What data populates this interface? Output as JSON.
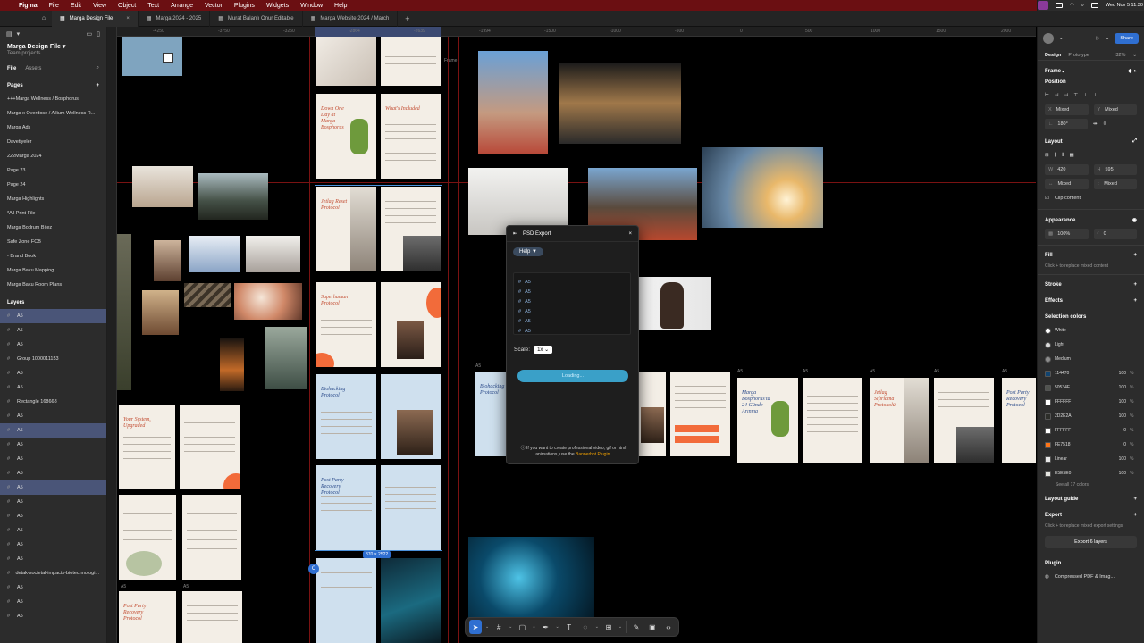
{
  "menubar": {
    "app": "Figma",
    "menus": [
      "File",
      "Edit",
      "View",
      "Object",
      "Text",
      "Arrange",
      "Vector",
      "Plugins",
      "Widgets",
      "Window",
      "Help"
    ],
    "clock": "Wed Nov 5  11:30"
  },
  "tabs": [
    {
      "label": "Marga Design File",
      "active": true
    },
    {
      "label": "Marga 2024 - 2025",
      "active": false
    },
    {
      "label": "Murat Balanlı Onur Editable",
      "active": false
    },
    {
      "label": "Marga Website 2024 / March",
      "active": false
    }
  ],
  "left": {
    "file_name": "Marga Design File",
    "team": "Team projects",
    "file_tab": "File",
    "assets_tab": "Assets",
    "pages_label": "Pages",
    "pages": [
      "+++Marga Wellness / Bosphorus",
      "Marga x Overdose / Allium Wellness R...",
      "Marga Ads",
      "Davetiyeler",
      "222Marga 2024",
      "Page 23",
      "Page 24",
      "Marga Highlights",
      "*All Print File",
      "Marga Bodrum Bitez",
      "Safe Zone FCB",
      "- Brand Book",
      "Marga Baku Mapping",
      "Marga Baku Room Plans"
    ],
    "layers_label": "Layers",
    "layers": [
      {
        "label": "A5",
        "selected": true
      },
      {
        "label": "A5",
        "selected": false
      },
      {
        "label": "A5",
        "selected": false
      },
      {
        "label": "Group 1000011153",
        "selected": false
      },
      {
        "label": "A5",
        "selected": false
      },
      {
        "label": "A5",
        "selected": false
      },
      {
        "label": "Rectangle 168668",
        "selected": false
      },
      {
        "label": "A5",
        "selected": false
      },
      {
        "label": "A5",
        "selected": true
      },
      {
        "label": "A5",
        "selected": false
      },
      {
        "label": "A5",
        "selected": false
      },
      {
        "label": "A5",
        "selected": false
      },
      {
        "label": "A5",
        "selected": true
      },
      {
        "label": "A5",
        "selected": false
      },
      {
        "label": "A5",
        "selected": false
      },
      {
        "label": "A5",
        "selected": false
      },
      {
        "label": "A5",
        "selected": false
      },
      {
        "label": "A5",
        "selected": false
      },
      {
        "label": "detak-societal-impacts-biotechnologi...",
        "selected": false
      },
      {
        "label": "A5",
        "selected": false
      },
      {
        "label": "A5",
        "selected": false
      },
      {
        "label": "A5",
        "selected": false
      }
    ]
  },
  "ruler": {
    "ticks": [
      "-4250",
      "-3750",
      "-3250",
      "-2864",
      "-2639",
      "-1994",
      "-1500",
      "-1000",
      "-500",
      "0",
      "500",
      "1000",
      "1500",
      "2000"
    ]
  },
  "canvas": {
    "frame_label": "Frame",
    "a5_label": "A5",
    "selection_size": "870 × 2522",
    "docs": [
      {
        "title": "Down One Day at Marga Bosphorus",
        "color": "red"
      },
      {
        "title": "What's Included",
        "color": "red"
      },
      {
        "title": "Jetlag Reset Protocol",
        "color": "red"
      },
      {
        "title": "Superhuman Protocol",
        "color": "red"
      },
      {
        "title": "Biohacking Protocol",
        "color": "blue"
      },
      {
        "title": "Post Party Recovery Protocol",
        "color": "blue"
      },
      {
        "title": "Your System, Upgraded",
        "color": "red"
      },
      {
        "title": "Post Party Recovery Protocol",
        "color": "red"
      },
      {
        "title": "Marga Bosphorus'ta 24 Günde Arınma",
        "color": "blue"
      },
      {
        "title": "Jetlag Sıfırlama Protokolü",
        "color": "red"
      }
    ]
  },
  "psd_export": {
    "title": "PSD Export",
    "help": "Help ▼",
    "items": [
      "A5",
      "A5",
      "A5",
      "A5",
      "A5",
      "A5"
    ],
    "scale_label": "Scale:",
    "scale_value": "1x",
    "loading": "Loading...",
    "note_prefix": "If you want to create professional video, gif or html animations, use the",
    "note_link": "Bannerbot Plugin."
  },
  "right": {
    "share": "Share",
    "zoom": "32%",
    "design_tab": "Design",
    "prototype_tab": "Prototype",
    "frame_label": "Frame",
    "position_label": "Position",
    "x_label": "X",
    "x_value": "Mixed",
    "y_label": "Y",
    "y_value": "Mixed",
    "rotation": "180°",
    "layout_label": "Layout",
    "w_label": "W",
    "w_value": "420",
    "h_label": "H",
    "h_value": "595",
    "w_mixed": "Mixed",
    "h_mixed": "Mixed",
    "clip_content": "Clip content",
    "appearance_label": "Appearance",
    "opacity": "100%",
    "radius": "0",
    "fill_label": "Fill",
    "fill_hint": "Click + to replace mixed content",
    "stroke_label": "Stroke",
    "effects_label": "Effects",
    "selection_colors_label": "Selection colors",
    "colors": [
      {
        "name": "White",
        "hex": "#ffffff",
        "style": true
      },
      {
        "name": "Light",
        "hex": "#d9d9d9",
        "style": true
      },
      {
        "name": "Medium",
        "hex": "#8c8c8c",
        "style": true
      },
      {
        "name": "114470",
        "hex": "#114470",
        "pct": "100"
      },
      {
        "name": "50534F",
        "hex": "#50534f",
        "pct": "100"
      },
      {
        "name": "FFFFFF",
        "hex": "#ffffff",
        "pct": "100"
      },
      {
        "name": "2D2E2A",
        "hex": "#2d2e2a",
        "pct": "100"
      },
      {
        "name": "FFFFFF",
        "hex": "#ffffff",
        "pct": "0"
      },
      {
        "name": "FE7518",
        "hex": "#fe7518",
        "pct": "0"
      },
      {
        "name": "Linear",
        "hex": "#e8e8e8",
        "pct": "100"
      },
      {
        "name": "E5E5E0",
        "hex": "#e5e5e0",
        "pct": "100"
      }
    ],
    "see_all": "See all 17 colors",
    "layout_guide_label": "Layout guide",
    "export_label": "Export",
    "export_hint": "Click + to replace mixed export settings",
    "export_button": "Export 6 layers",
    "plugin_label": "Plugin",
    "plugin_name": "Compressed PDF & Imag..."
  },
  "colors": {
    "menubar": "#6b0f12",
    "accent": "#2f6fd1",
    "selection": "#4a90d9"
  }
}
